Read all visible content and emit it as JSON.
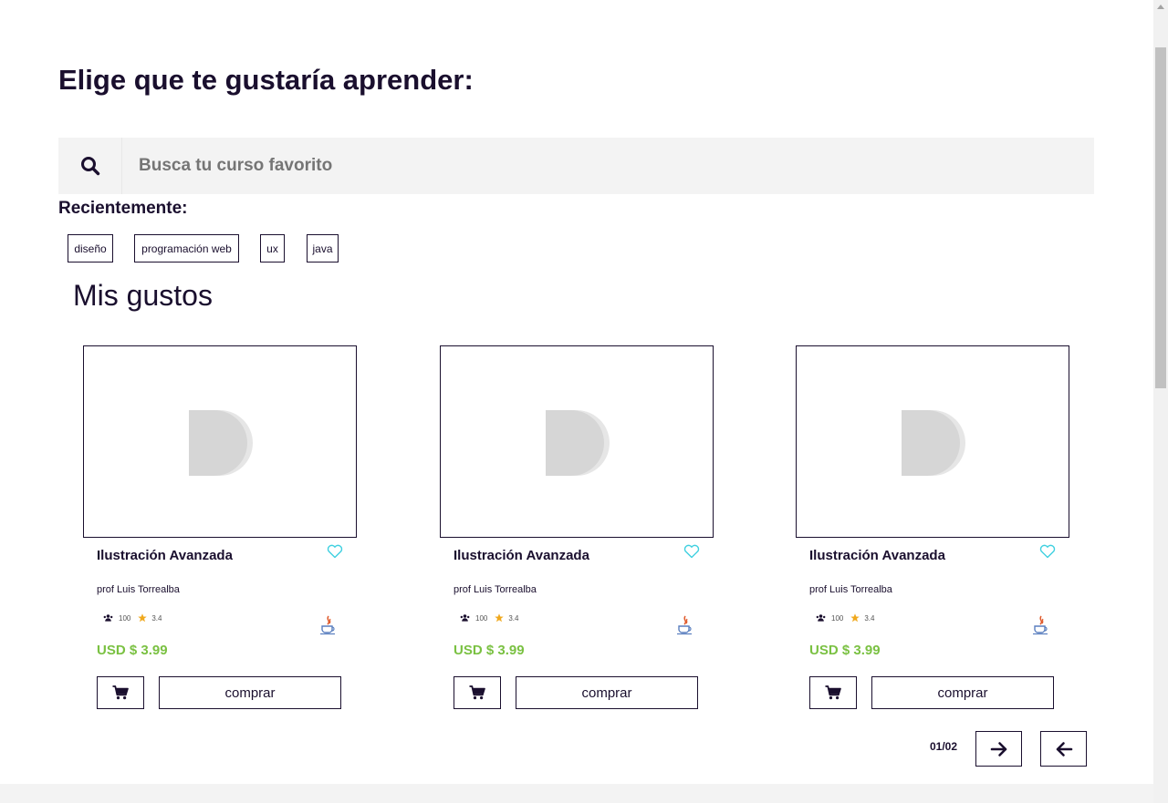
{
  "header": {
    "title": "Elige que te gustaría aprender:"
  },
  "search": {
    "placeholder": "Busca tu curso favorito",
    "icon": "search-icon"
  },
  "recent": {
    "label": "Recientemente:",
    "chips": [
      "diseño",
      "programación web",
      "ux",
      "java"
    ]
  },
  "section": {
    "title": "Mis gustos"
  },
  "courses": [
    {
      "title": "Ilustración Avanzada",
      "teacher": "prof Luis Torrealba",
      "students": "100",
      "rating": "3.4",
      "price": "USD $ 3.99",
      "buy_label": "comprar"
    },
    {
      "title": "Ilustración Avanzada",
      "teacher": "prof Luis Torrealba",
      "students": "100",
      "rating": "3.4",
      "price": "USD $ 3.99",
      "buy_label": "comprar"
    },
    {
      "title": "Ilustración Avanzada",
      "teacher": "prof Luis Torrealba",
      "students": "100",
      "rating": "3.4",
      "price": "USD $ 3.99",
      "buy_label": "comprar"
    }
  ],
  "pagination": {
    "label": "01/02"
  },
  "colors": {
    "text": "#1a0f2e",
    "price": "#7ac142",
    "heart": "#3fd0e0",
    "star": "#f0a91e",
    "search_bg": "#f3f3f3"
  }
}
